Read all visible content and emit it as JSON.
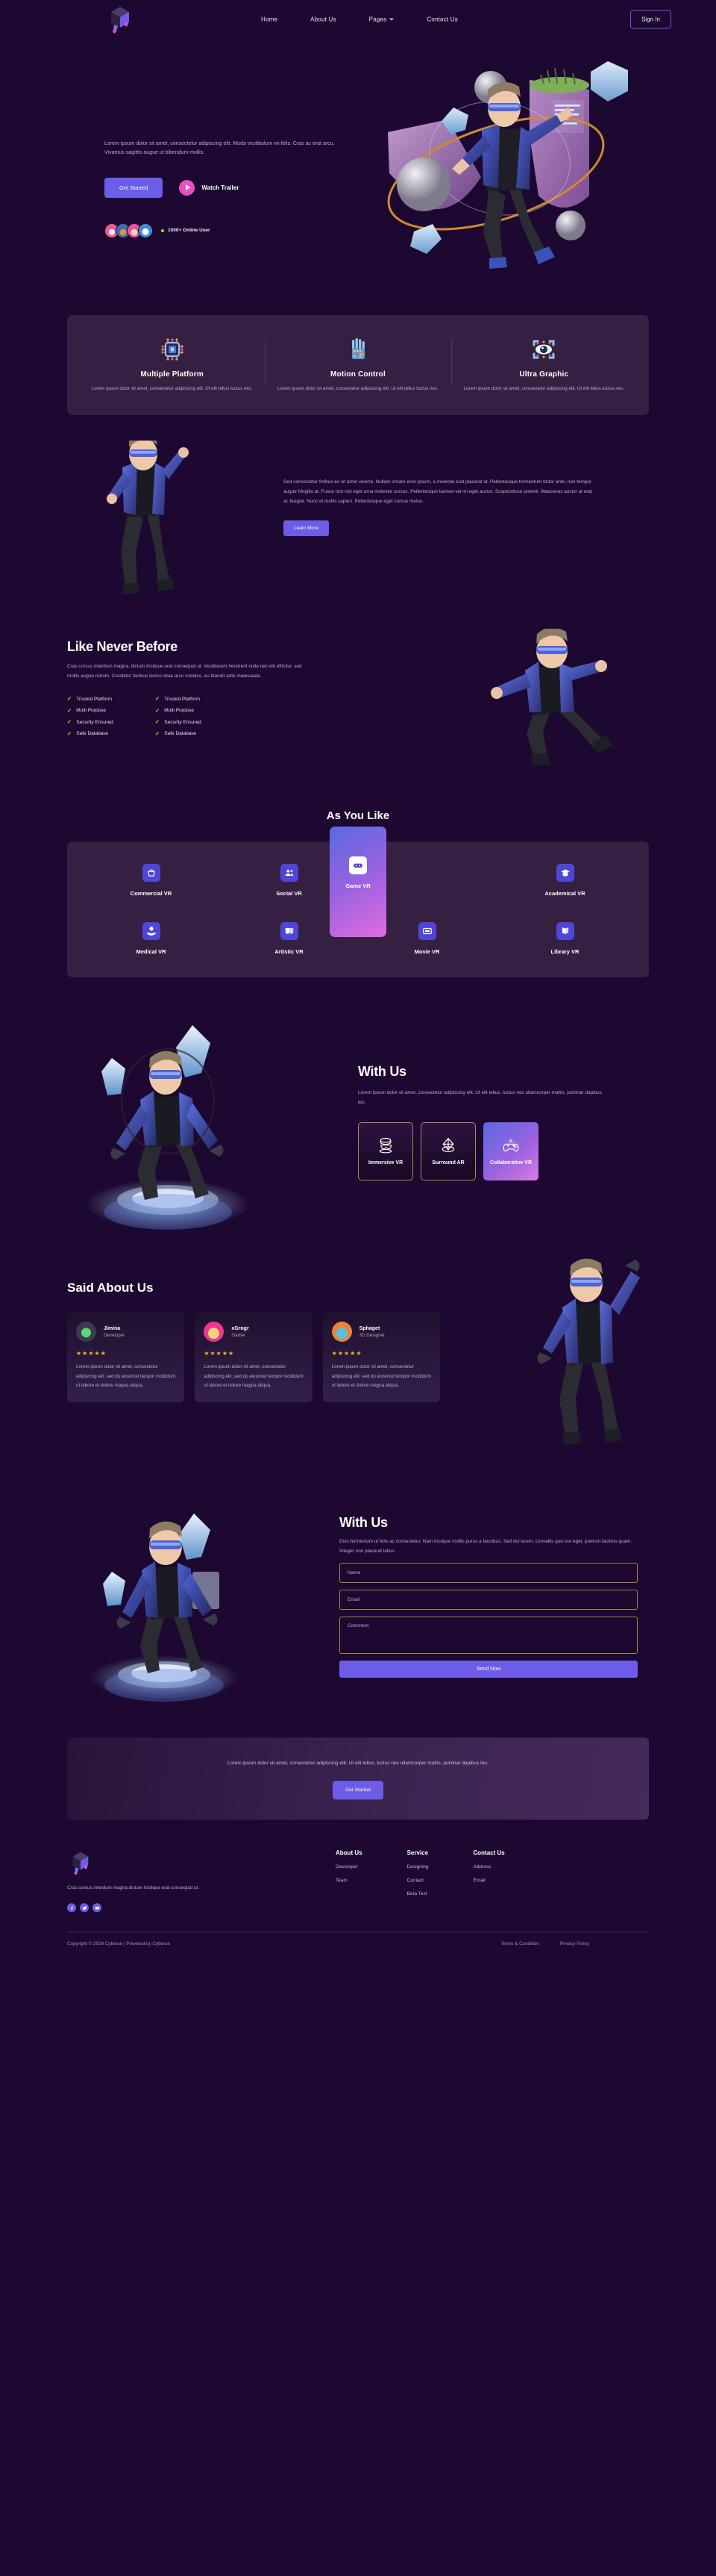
{
  "brand": {
    "name": "Cyberse",
    "logo_icon": "cube-logo-icon"
  },
  "nav": {
    "links": [
      {
        "label": "Home",
        "icon": null
      },
      {
        "label": "About Us",
        "icon": null
      },
      {
        "label": "Pages",
        "icon": "chevron-down-icon"
      },
      {
        "label": "Contact Us",
        "icon": null
      }
    ],
    "signin_label": "Sign In"
  },
  "hero": {
    "paragraph": "Lorem ipsum dolor sit amet, consectetur adipiscing elit. Morbi vestibulum mi felis. Cras ac erat arcu. Vivamus sagittis augue ut bibendum mollis.",
    "primary_cta": "Get Started",
    "watch_label": "Watch Trailer",
    "play_icon": "play-icon",
    "online_count": "1000+ Online User",
    "art_alt": "vr-hero-illustration"
  },
  "features": [
    {
      "icon": "chip-icon",
      "title": "Multiple Platform",
      "desc": "Lorem ipsum dolor sit amet, consectetur adipiscing elit. Ut elit tellus luctus nec."
    },
    {
      "icon": "robotic-hand-icon",
      "title": "Motion Control",
      "desc": "Lorem ipsum dolor sit amet, consectetur adipiscing elit. Ut elit tellus luctus nec."
    },
    {
      "icon": "eye-scan-icon",
      "title": "Ultra Graphic",
      "desc": "Lorem ipsum dolor sit amet, consectetur adipiscing elit. Ut elit tellus luctus nec."
    }
  ],
  "info": {
    "paragraph": "Sed consectetur finibus ex sit amet viverra. Nullam ornare eros ipsum, a molestie erat placerat id. Pellentesque fermentum tortor ante, non tempor augue fringilla at. Fusce non nisl eget urna molestie cursus. Pellentesque laoreet vel mi eget auctor. Suspendisse potenti. Maecenas auctor at erat ac feugiat. Nunc et mollis sapien. Pellentesque eget cursus metus.",
    "cta": "Learn More",
    "art_alt": "vr-pointing-illustration"
  },
  "like_never_before": {
    "heading": "Like Never Before",
    "paragraph": "Cras cursus interdum magna, dictum tristique erat consequat ut. Vestibulum hendrerit nulla nec elit efficitur, sed mollis augue rutrum. Curabitur facilisis lectus vitae arcu sodales, eu blandit ante malesuada.",
    "list_left": [
      "Trusted Platform",
      "Multi Purpose",
      "Security Ensured",
      "Safe Database"
    ],
    "list_right": [
      "Trusted Platform",
      "Multi Purpose",
      "Security Ensured",
      "Safe Database"
    ],
    "check_icon": "check-icon",
    "art_alt": "vr-flying-illustration"
  },
  "as_you_like": {
    "heading": "As You Like",
    "items": [
      {
        "label": "Commercial VR",
        "icon": "basket-icon",
        "active": false
      },
      {
        "label": "Social VR",
        "icon": "people-icon",
        "active": false
      },
      {
        "label": "Academical VR",
        "icon": "graduation-cap-icon",
        "active": false
      },
      {
        "label": "Medical VR",
        "icon": "medical-hand-icon",
        "active": false
      },
      {
        "label": "Artistic VR",
        "icon": "theatre-masks-icon",
        "active": false
      },
      {
        "label": "Movie VR",
        "icon": "screen-icon",
        "active": false
      },
      {
        "label": "Library VR",
        "icon": "open-book-icon",
        "active": false
      }
    ],
    "active_item": {
      "label": "Game VR",
      "icon": "gamepad-icon",
      "active": true
    }
  },
  "with_us": {
    "heading": "With Us",
    "paragraph": "Lorem ipsum dolor sit amet, consectetur adipiscing elit. Ut elit tellus, luctus nec ullamcorper mattis, pulvinar dapibus leo.",
    "tabs": [
      {
        "label": "Immersive VR",
        "icon": "vr-headset-icon",
        "active": false
      },
      {
        "label": "Surround AR",
        "icon": "diamond-icon",
        "active": false
      },
      {
        "label": "Collaborative VR",
        "icon": "gamepad-outline-icon",
        "active": true
      }
    ],
    "art_alt": "vr-seated-illustration"
  },
  "testimonials": {
    "heading": "Said About Us",
    "cards": [
      {
        "avatar": "robot-avatar-green",
        "name": "Jimina",
        "role": "Developer",
        "stars": "★★★★★",
        "body": "Lorem ipsum dolor sit amet, consectetur adipiscing elit, sed do eiusmod tempor incididunt ut labore et dolore magna aliqua."
      },
      {
        "avatar": "robot-avatar-pink",
        "name": "xGrogr",
        "role": "Gamer",
        "stars": "★★★★★",
        "body": "Lorem ipsum dolor sit amet, consectetur adipiscing elit, sed do eiusmod tempor incididunt ut labore et dolore magna aliqua."
      },
      {
        "avatar": "robot-avatar-orange",
        "name": "Sphaget",
        "role": "3D Designer",
        "stars": "★★★★★",
        "body": "Lorem ipsum dolor sit amet, consectetur adipiscing elit, sed do eiusmod tempor incididunt ut labore et dolore magna aliqua."
      }
    ],
    "art_alt": "vr-waving-illustration"
  },
  "contact": {
    "heading": "With Us",
    "paragraph": "Duis fermentum ut felis ac consectetur. Nam tristique mollis purus a faucibus. Sed dui lorem, convallis quis est eget, pretium facilisis quam. Integer non placerat tellus.",
    "name_placeholder": "Name",
    "email_placeholder": "Email",
    "comment_placeholder": "Comment",
    "submit_label": "Send Now",
    "name_value": "",
    "email_value": "",
    "comment_value": "",
    "art_alt": "vr-standing-illustration"
  },
  "cta_band": {
    "paragraph": "Lorem ipsum dolor sit amet, consectetur adipiscing elit. Ut elit tellus, luctus nec ullamcorper mattis, pulvinar dapibus leo.",
    "button": "Get Started"
  },
  "footer": {
    "tagline": "Cras cursus interdum magna dictum tristique erat consequat ut.",
    "socials": [
      {
        "name": "facebook-icon"
      },
      {
        "name": "twitter-icon"
      },
      {
        "name": "youtube-icon"
      }
    ],
    "columns": [
      {
        "title": "About Us",
        "links": [
          "Developer",
          "Team"
        ]
      },
      {
        "title": "Service",
        "links": [
          "Designing",
          "Contact",
          "Beta Test"
        ]
      },
      {
        "title": "Contact Us",
        "links": [
          "Address",
          "Email"
        ]
      }
    ],
    "copyright": "Copyright © 2024 Cyberse | Powered by Cyberse",
    "legal": [
      "Terms & Condition",
      "Privacy Policy"
    ]
  },
  "colors": {
    "background": "#1c0830",
    "card": "#352042",
    "accent": "#6c5ce7",
    "pink": "#e84fc4",
    "gold": "#b08a4a",
    "star": "#f5b61a",
    "online_dot": "#8fe032"
  }
}
